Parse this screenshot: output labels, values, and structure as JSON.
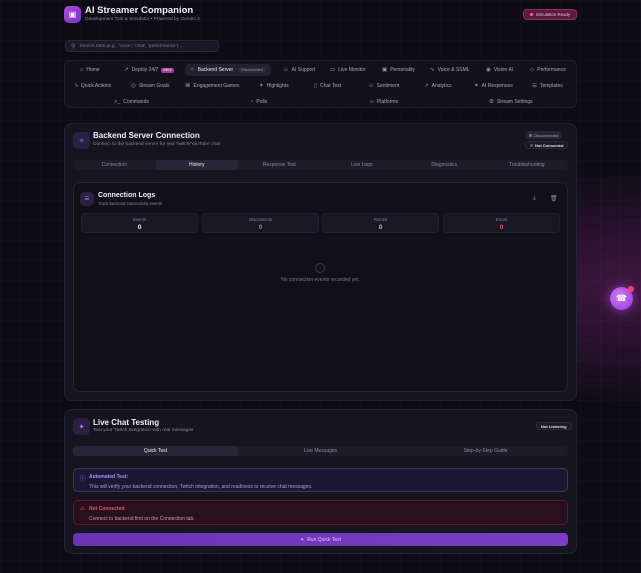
{
  "header": {
    "title": "AI Streamer Companion",
    "subtitle": "Development Tool & Simulator • Powered by Gemini 3",
    "sim_badge": "Simulation Ready"
  },
  "search": {
    "placeholder": "Search tabs (e.g., 'voice', 'chat', 'performance')..."
  },
  "nav": {
    "row1": [
      {
        "label": "Home",
        "icon": "home-icon",
        "glyph": "⌂"
      },
      {
        "label": "Deploy 24/7",
        "icon": "rocket-icon",
        "glyph": "↗",
        "tag": "NEW"
      },
      {
        "label": "Backend Server",
        "icon": "plug-icon",
        "glyph": "✧",
        "tag": "Disconnected"
      },
      {
        "label": "AI Support",
        "icon": "bot-icon",
        "glyph": "☺"
      },
      {
        "label": "Live Monitor",
        "icon": "monitor-icon",
        "glyph": "▭"
      },
      {
        "label": "Personality",
        "icon": "personality-icon",
        "glyph": "▣"
      },
      {
        "label": "Voice & SSML",
        "icon": "waveform-icon",
        "glyph": "∿"
      },
      {
        "label": "Vision AI",
        "icon": "eye-icon",
        "glyph": "◉"
      },
      {
        "label": "Performance",
        "icon": "gauge-icon",
        "glyph": "◇"
      }
    ],
    "row2": [
      {
        "label": "Quick Actions",
        "icon": "bolt-icon",
        "glyph": "ϟ"
      },
      {
        "label": "Stream Goals",
        "icon": "target-icon",
        "glyph": "◎"
      },
      {
        "label": "Engagement Games",
        "icon": "gamepad-icon",
        "glyph": "⌘"
      },
      {
        "label": "Highlights",
        "icon": "sparkle-icon",
        "glyph": "✦"
      },
      {
        "label": "Chat Test",
        "icon": "chat-icon",
        "glyph": "▯"
      },
      {
        "label": "Sentiment",
        "icon": "smile-icon",
        "glyph": "☺"
      },
      {
        "label": "Analytics",
        "icon": "chart-icon",
        "glyph": "↗"
      },
      {
        "label": "AI Responses",
        "icon": "brain-icon",
        "glyph": "✦"
      },
      {
        "label": "Templates",
        "icon": "template-icon",
        "glyph": "☰"
      }
    ],
    "row3": [
      {
        "label": "Commands",
        "icon": "terminal-icon",
        "glyph": ">_"
      },
      {
        "label": "Polls",
        "icon": "poll-icon",
        "glyph": "◔"
      },
      {
        "label": "Platforms",
        "icon": "link-icon",
        "glyph": "∞"
      },
      {
        "label": "Stream Settings",
        "icon": "gear-icon",
        "glyph": "⚙"
      }
    ]
  },
  "backend": {
    "title": "Backend Server Connection",
    "subtitle": "Connect to the backend server for real Twitch/YouTube chat",
    "status_pill": "Disconnected",
    "conn_pill": "Not Connected",
    "tabs": [
      "Connection",
      "History",
      "Response Test",
      "Live Logs",
      "Diagnostics",
      "Troubleshooting"
    ],
    "active_tab": "History",
    "logs": {
      "title": "Connection Logs",
      "subtitle": "Track backend connectivity events",
      "stats": [
        {
          "label": "Events",
          "value": "0",
          "color": "#f2f1f8"
        },
        {
          "label": "Disconnects",
          "value": "0",
          "color": "#8b8a9c"
        },
        {
          "label": "Retries",
          "value": "0",
          "color": "#e9b73a"
        },
        {
          "label": "Errors",
          "value": "0",
          "color": "#ef4b5c"
        }
      ],
      "empty_text": "No connection events recorded yet."
    }
  },
  "live_chat": {
    "title": "Live Chat Testing",
    "subtitle": "Test your Twitch integration with real messages",
    "status_pill": "Not Listening",
    "tabs": [
      "Quick Test",
      "Live Messages",
      "Step-by-Step Guide"
    ],
    "active_tab": "Quick Test",
    "info_alert": {
      "title": "Automated Test:",
      "text": "This will verify your backend connection, Twitch integration, and readiness to receive chat messages."
    },
    "error_alert": {
      "title": "Not Connected",
      "text": "Connect to backend first on the Connection tab."
    },
    "run_button": "Run Quick Test"
  },
  "colors": {
    "accent": "#7b3cc6",
    "brand_pink": "#a6389a",
    "error": "#ef4b5c",
    "warning": "#e9b73a"
  }
}
